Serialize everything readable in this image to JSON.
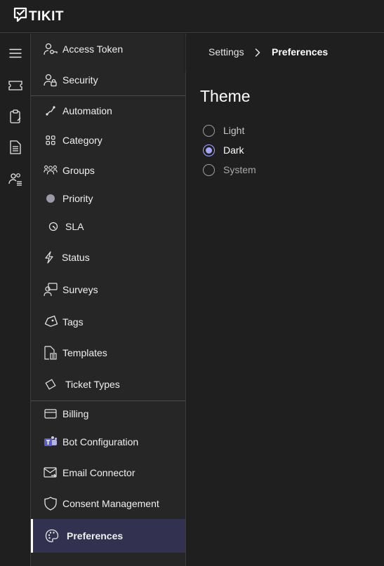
{
  "app": {
    "name": "TIKIT"
  },
  "rail": {
    "items": [
      "hamburger-menu-icon",
      "ticket-icon",
      "clipboard-icon",
      "document-icon",
      "people-list-icon"
    ]
  },
  "nav": {
    "items": [
      {
        "id": "access-token",
        "label": "Access Token",
        "icon": "key-person-icon"
      },
      {
        "id": "security",
        "label": "Security",
        "icon": "person-lock-icon"
      },
      {
        "id": "automation",
        "label": "Automation",
        "icon": "flow-icon"
      },
      {
        "id": "category",
        "label": "Category",
        "icon": "grid-icon"
      },
      {
        "id": "groups",
        "label": "Groups",
        "icon": "people-group-icon"
      },
      {
        "id": "priority",
        "label": "Priority",
        "icon": "dot-icon"
      },
      {
        "id": "sla",
        "label": "SLA",
        "icon": "gauge-icon"
      },
      {
        "id": "status",
        "label": "Status",
        "icon": "flash-icon"
      },
      {
        "id": "surveys",
        "label": "Surveys",
        "icon": "person-feedback-icon"
      },
      {
        "id": "tags",
        "label": "Tags",
        "icon": "tag-icon"
      },
      {
        "id": "templates",
        "label": "Templates",
        "icon": "document-template-icon"
      },
      {
        "id": "ticket-types",
        "label": "Ticket Types",
        "icon": "diamond-tag-icon"
      },
      {
        "id": "billing",
        "label": "Billing",
        "icon": "wallet-icon"
      },
      {
        "id": "bot-configuration",
        "label": "Bot Configuration",
        "icon": "teams-icon"
      },
      {
        "id": "email-connector",
        "label": "Email Connector",
        "icon": "mail-arrow-icon"
      },
      {
        "id": "consent-management",
        "label": "Consent Management",
        "icon": "shield-icon"
      },
      {
        "id": "preferences",
        "label": "Preferences",
        "icon": "palette-icon",
        "active": true
      }
    ]
  },
  "breadcrumb": {
    "parent": "Settings",
    "separator": "›",
    "current": "Preferences"
  },
  "theme": {
    "title": "Theme",
    "options": [
      {
        "label": "Light",
        "checked": false
      },
      {
        "label": "Dark",
        "checked": true
      },
      {
        "label": "System",
        "checked": false
      }
    ]
  },
  "colors": {
    "accent": "#a6a6ff",
    "active_nav_bg": "#323250",
    "background": "#1f1f1f",
    "nav_bg": "#262626"
  }
}
